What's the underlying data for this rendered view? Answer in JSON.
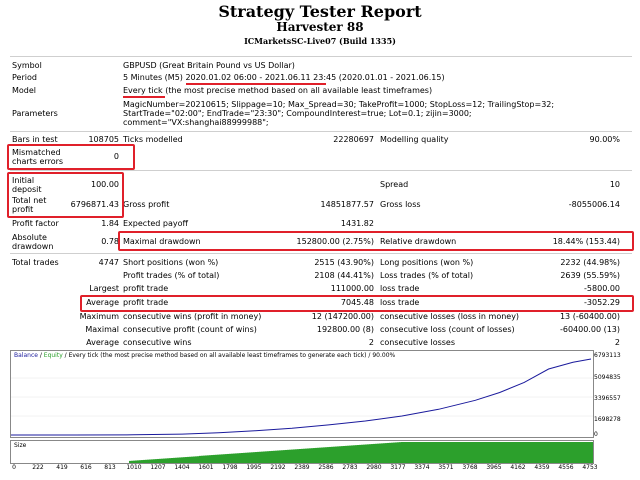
{
  "title": "Strategy Tester Report",
  "ea": "Harvester 88",
  "server": "ICMarketsSC-Live07 (Build 1335)",
  "rows": {
    "symbol": {
      "label": "Symbol",
      "value": "GBPUSD (Great Britain Pound vs US Dollar)"
    },
    "period": {
      "label": "Period",
      "value": "5 Minutes (M5) 2020.01.02 06:00 - 2021.06.11 23:45 (2020.01.01 - 2021.06.15)"
    },
    "model": {
      "label": "Model",
      "value": "Every tick (the most precise method based on all available least timeframes)"
    },
    "parameters": {
      "label": "Parameters",
      "lines": [
        "MagicNumber=20210615; Slippage=10; Max_Spread=30; TakeProfit=1000; StopLoss=12; TrailingStop=32;",
        "StartTrade=\"02:00\"; EndTrade=\"23:30\"; CompoundInterest=true; Lot=0.1; zijin=3000;",
        "comment=\"VX:shanghai88999988\";"
      ]
    },
    "bars": {
      "label": "Bars in test",
      "value": "108705",
      "ticks_label": "Ticks modelled",
      "ticks_value": "22280697",
      "quality_label": "Modelling quality",
      "quality_value": "90.00%"
    },
    "mismatched": {
      "label1": "Mismatched",
      "label2": "charts errors",
      "value": "0"
    },
    "initial": {
      "label1": "Initial",
      "label2": "deposit",
      "value": "100.00",
      "spread_label": "Spread",
      "spread_value": "10"
    },
    "net": {
      "label1": "Total net",
      "label2": "profit",
      "value": "6796871.43",
      "gp_label": "Gross profit",
      "gp_value": "14851877.57",
      "gl_label": "Gross loss",
      "gl_value": "-8055006.14"
    },
    "pf": {
      "label": "Profit factor",
      "value": "1.84",
      "ep_label": "Expected payoff",
      "ep_value": "1431.82"
    },
    "dd": {
      "label1": "Absolute",
      "label2": "drawdown",
      "value": "0.78",
      "max_label": "Maximal drawdown",
      "max_value": "152800.00 (2.75%)",
      "rel_label": "Relative drawdown",
      "rel_value": "18.44% (153.44)"
    },
    "trades": {
      "label": "Total trades",
      "value": "4747",
      "short_label": "Short positions (won %)",
      "short_value": "2515 (43.90%)",
      "long_label": "Long positions (won %)",
      "long_value": "2232 (44.98%)",
      "pt_label": "Profit trades (% of total)",
      "pt_value": "2108 (44.41%)",
      "lt_label": "Loss trades (% of total)",
      "lt_value": "2639 (55.59%)",
      "largest": "Largest",
      "lp_label": "profit trade",
      "lp_value": "111000.00",
      "ll_label": "loss trade",
      "ll_value": "-5800.00",
      "average": "Average",
      "ap_label": "profit trade",
      "ap_value": "7045.48",
      "al_label": "loss trade",
      "al_value": "-3052.29",
      "maximum": "Maximum",
      "mcw_label": "consecutive wins (profit in money)",
      "mcw_value": "12 (147200.00)",
      "mcl_label": "consecutive losses (loss in money)",
      "mcl_value": "13 (-60400.00)",
      "maximal": "Maximal",
      "mcp_label": "consecutive profit (count of wins)",
      "mcp_value": "192800.00 (8)",
      "mcll_label": "consecutive loss (count of losses)",
      "mcll_value": "-60400.00 (13)",
      "average2": "Average",
      "acw_label": "consecutive wins",
      "acw_value": "2",
      "acl_label": "consecutive losses",
      "acl_value": "2"
    }
  },
  "chart": {
    "legend_balance": "Balance",
    "legend_sep": " / ",
    "legend_equity": "Equity",
    "legend_rest": " / Every tick (the most precise method based on all available least timeframes to generate each tick) / 90.00%",
    "size_label": "Size",
    "balance_color": "#1a1a9c",
    "equity_color": "#2ca02c",
    "y_ticks": [
      "6793113",
      "5094835",
      "3396557",
      "1698278",
      "0"
    ],
    "x_ticks": [
      "0",
      "222",
      "419",
      "616",
      "813",
      "1010",
      "1207",
      "1404",
      "1601",
      "1798",
      "1995",
      "2192",
      "2389",
      "2586",
      "2783",
      "2980",
      "3177",
      "3374",
      "3571",
      "3768",
      "3965",
      "4162",
      "4359",
      "4556",
      "4753"
    ]
  },
  "chart_data": {
    "type": "line",
    "x": [
      0,
      500,
      1000,
      1400,
      1700,
      2000,
      2300,
      2600,
      2900,
      3200,
      3500,
      3800,
      4000,
      4200,
      4400,
      4600,
      4747
    ],
    "series": [
      {
        "name": "Balance",
        "values": [
          100,
          3000,
          20000,
          80000,
          200000,
          380000,
          600000,
          900000,
          1250000,
          1700000,
          2300000,
          3100000,
          3800000,
          4700000,
          5900000,
          6500000,
          6796871
        ]
      }
    ],
    "ylim": [
      0,
      6793113
    ]
  }
}
